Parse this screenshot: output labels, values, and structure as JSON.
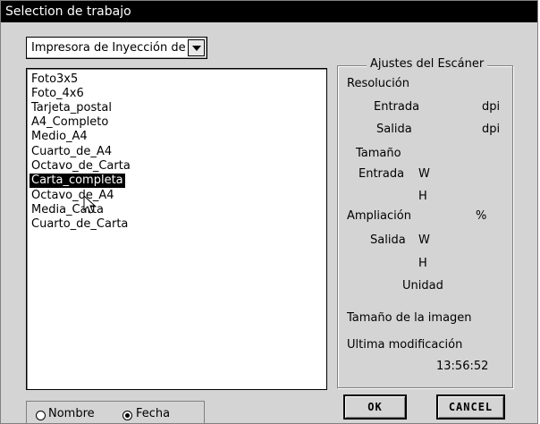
{
  "window": {
    "title": "Selection de trabajo"
  },
  "printer_select": {
    "value": "Impresora de Inyección de"
  },
  "job_list": {
    "items": [
      "Foto3x5",
      "Foto_4x6",
      "Tarjeta_postal",
      "A4_Completo",
      "Medio_A4",
      "Cuarto_de_A4",
      "Octavo_de_Carta",
      "Carta_completa",
      "Octavo_de_A4",
      "Media_Carta",
      "Cuarto_de_Carta"
    ],
    "selected": "Carta_completa"
  },
  "scanner_settings": {
    "title": "Ajustes del Escáner",
    "resolucion": "Resolución",
    "entrada": "Entrada",
    "salida": "Salida",
    "dpi_entrada": "dpi",
    "dpi_salida": "dpi",
    "tamano": "Tamaño",
    "tam_entrada": "Entrada",
    "w1": "W",
    "h1": "H",
    "ampliacion": "Ampliación",
    "percent": "%",
    "tam_salida": "Salida",
    "w2": "W",
    "h2": "H",
    "unidad": "Unidad",
    "tamano_imagen": "Tamaño de la imagen",
    "ultima_mod": "Ultima modificación",
    "time": "13:56:52"
  },
  "sort": {
    "nombre": "Nombre",
    "fecha": "Fecha",
    "selected": "Fecha"
  },
  "buttons": {
    "ok": "OK",
    "cancel": "CANCEL"
  },
  "colors": {
    "title_bg": "#000000",
    "dialog_bg": "#d4d4d4",
    "selection_bg": "#000000"
  }
}
